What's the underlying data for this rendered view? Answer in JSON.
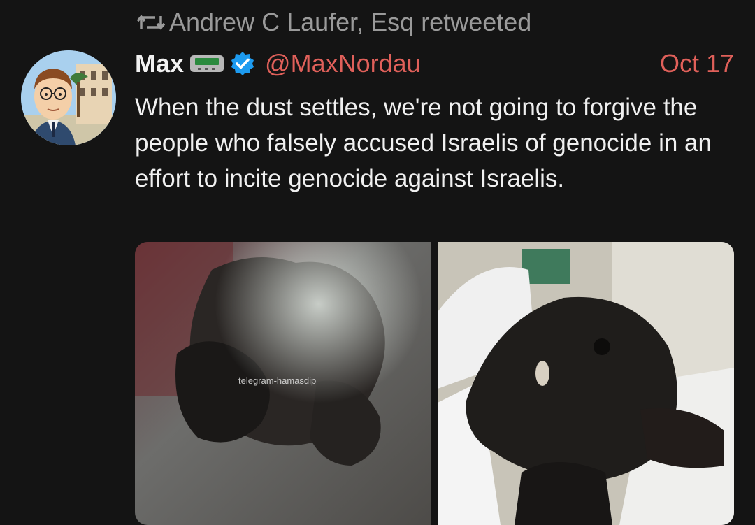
{
  "retweet": {
    "icon": "retweet-icon",
    "text": "Andrew C Laufer, Esq retweeted"
  },
  "author": {
    "display_name": "Max",
    "handle": "@MaxNordau",
    "verified": true,
    "badge_icon": "pager-icon",
    "verified_icon": "verified-badge-icon"
  },
  "date": "Oct 17",
  "text": "When the dust settles, we're not going to forgive the people who falsely accused Israelis of genocide in an effort to incite genocide against Israelis.",
  "media": [
    {
      "watermark": "telegram-hamasdip"
    },
    {}
  ],
  "colors": {
    "background": "#141414",
    "accent": "#e0605a",
    "muted": "#9a9a9a",
    "verified": "#1d9bf0"
  }
}
